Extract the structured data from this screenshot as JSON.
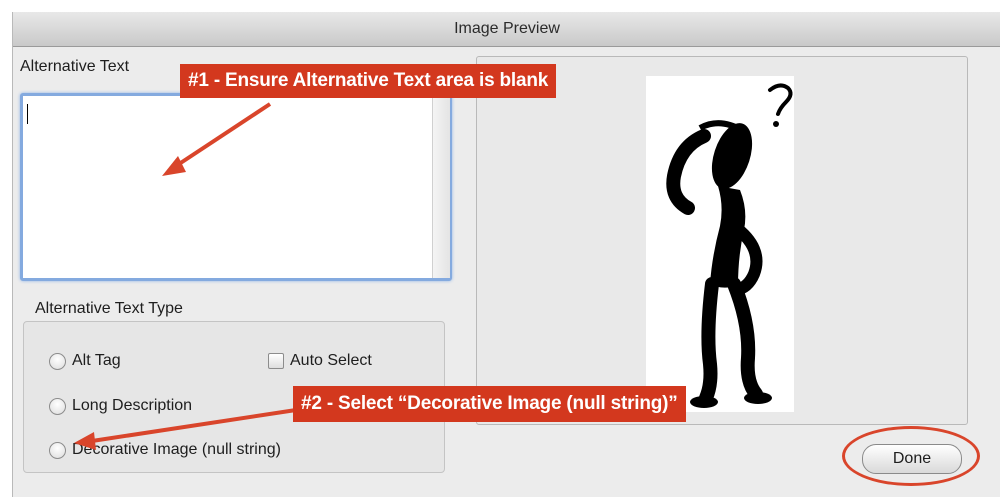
{
  "window": {
    "title": "Image Preview"
  },
  "alt_text": {
    "label": "Alternative Text",
    "value": ""
  },
  "alt_type": {
    "label": "Alternative Text Type",
    "options": [
      "Alt Tag",
      "Long Description",
      "Decorative Image (null string)"
    ],
    "auto_select_label": "Auto Select"
  },
  "buttons": {
    "done": "Done"
  },
  "annotations": {
    "note1": "#1 - Ensure Alternative Text area is blank",
    "note2": "#2 - Select “Decorative Image (null string)”",
    "color": "#d3381e"
  },
  "preview": {
    "icon": "question-figure-icon"
  }
}
